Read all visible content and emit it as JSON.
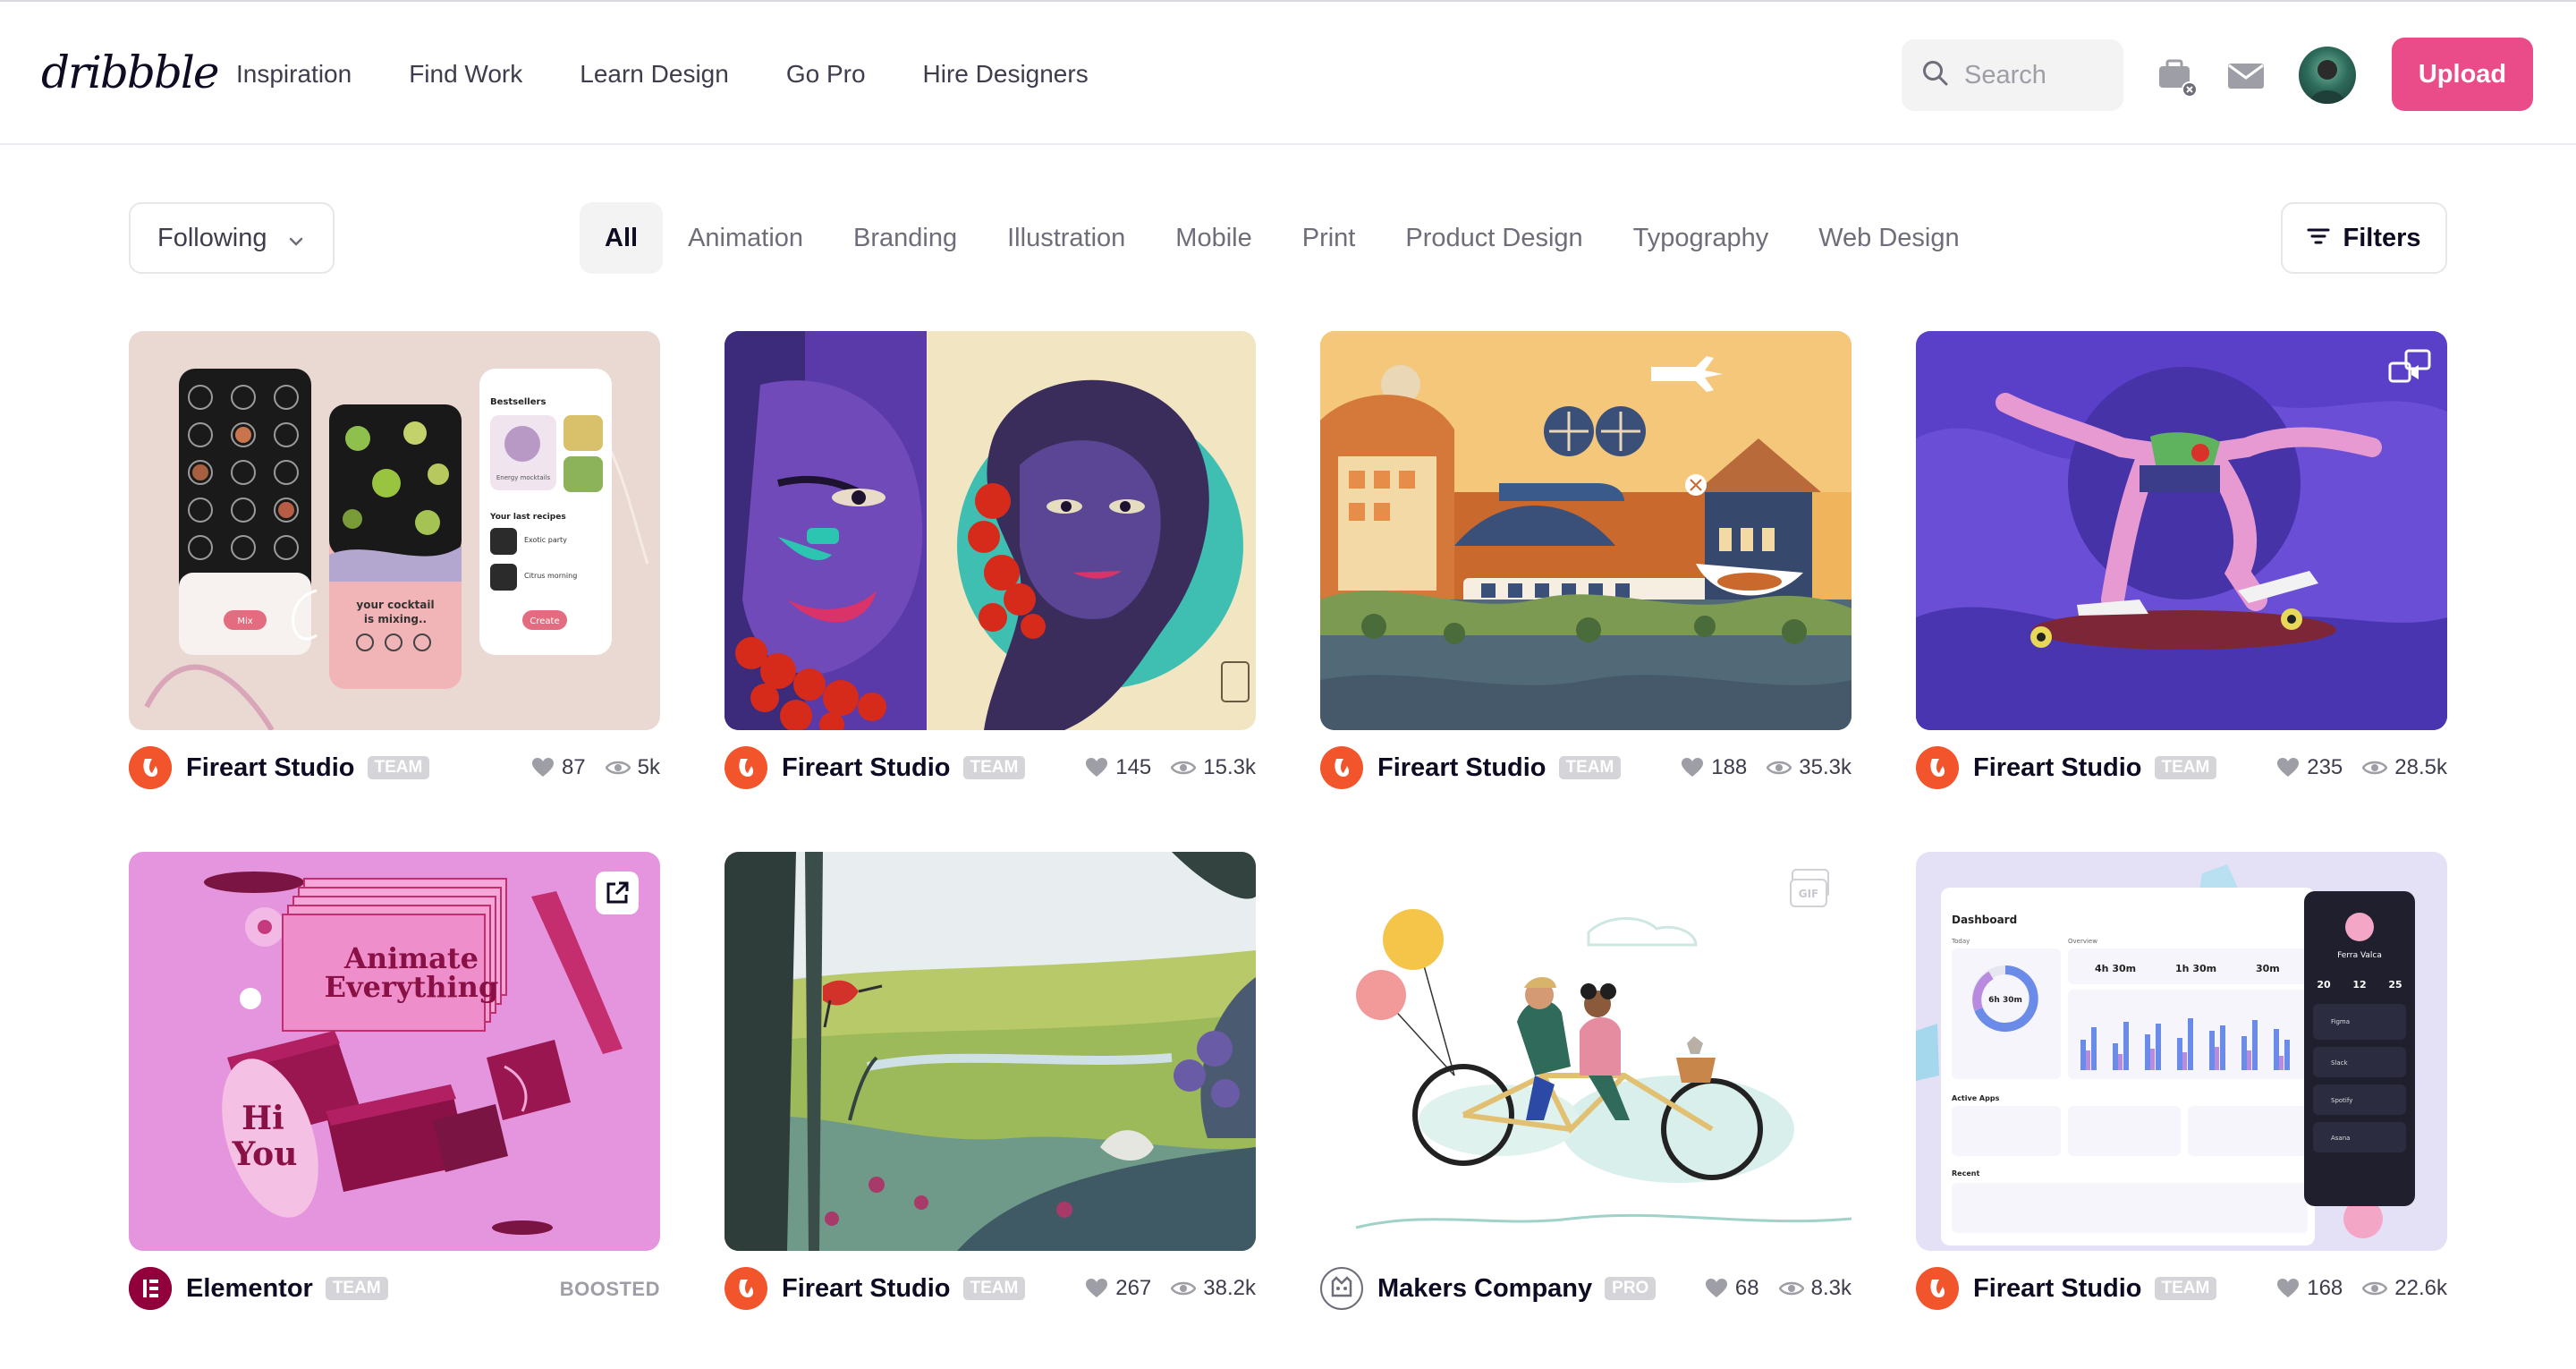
{
  "header": {
    "logo": "dribbble",
    "nav": [
      "Inspiration",
      "Find Work",
      "Learn Design",
      "Go Pro",
      "Hire Designers"
    ],
    "search_placeholder": "Search",
    "upload_label": "Upload"
  },
  "filterbar": {
    "following_label": "Following",
    "categories": [
      "All",
      "Animation",
      "Branding",
      "Illustration",
      "Mobile",
      "Print",
      "Product Design",
      "Typography",
      "Web Design"
    ],
    "active_category": "All",
    "filters_label": "Filters"
  },
  "shots": [
    {
      "author": "Fireart Studio",
      "badge": "TEAM",
      "likes": "87",
      "views": "5k"
    },
    {
      "author": "Fireart Studio",
      "badge": "TEAM",
      "likes": "145",
      "views": "15.3k"
    },
    {
      "author": "Fireart Studio",
      "badge": "TEAM",
      "likes": "188",
      "views": "35.3k"
    },
    {
      "author": "Fireart Studio",
      "badge": "TEAM",
      "likes": "235",
      "views": "28.5k",
      "overlay": "video-icon"
    },
    {
      "author": "Elementor",
      "badge": "TEAM",
      "boosted": "BOOSTED",
      "overlay": "external-link-icon",
      "artwork_text": [
        "Animate",
        "Everything",
        "Hi",
        "You"
      ]
    },
    {
      "author": "Fireart Studio",
      "badge": "TEAM",
      "likes": "267",
      "views": "38.2k"
    },
    {
      "author": "Makers Company",
      "badge": "PRO",
      "likes": "68",
      "views": "8.3k",
      "overlay": "gif-icon"
    },
    {
      "author": "Fireart Studio",
      "badge": "TEAM",
      "likes": "168",
      "views": "22.6k"
    }
  ],
  "mockup_text": {
    "shot1": [
      "Bestsellers",
      "Energy mocktails",
      "Your last recipes",
      "Exotic party",
      "Citrus morning",
      "Mix",
      "your cocktail is mixing..",
      "Create"
    ],
    "shot8": [
      "Dashboard",
      "Today",
      "Overview",
      "4h 30m",
      "1h 30m",
      "30m",
      "Ferra Valca",
      "20",
      "12",
      "25",
      "Active Apps",
      "Recent",
      "Figma",
      "Slack",
      "Spotify",
      "Asana"
    ]
  },
  "colors": {
    "brand_pink": "#ea4c89",
    "fireart_red": "#f2552c",
    "elementor": "#92003b"
  }
}
